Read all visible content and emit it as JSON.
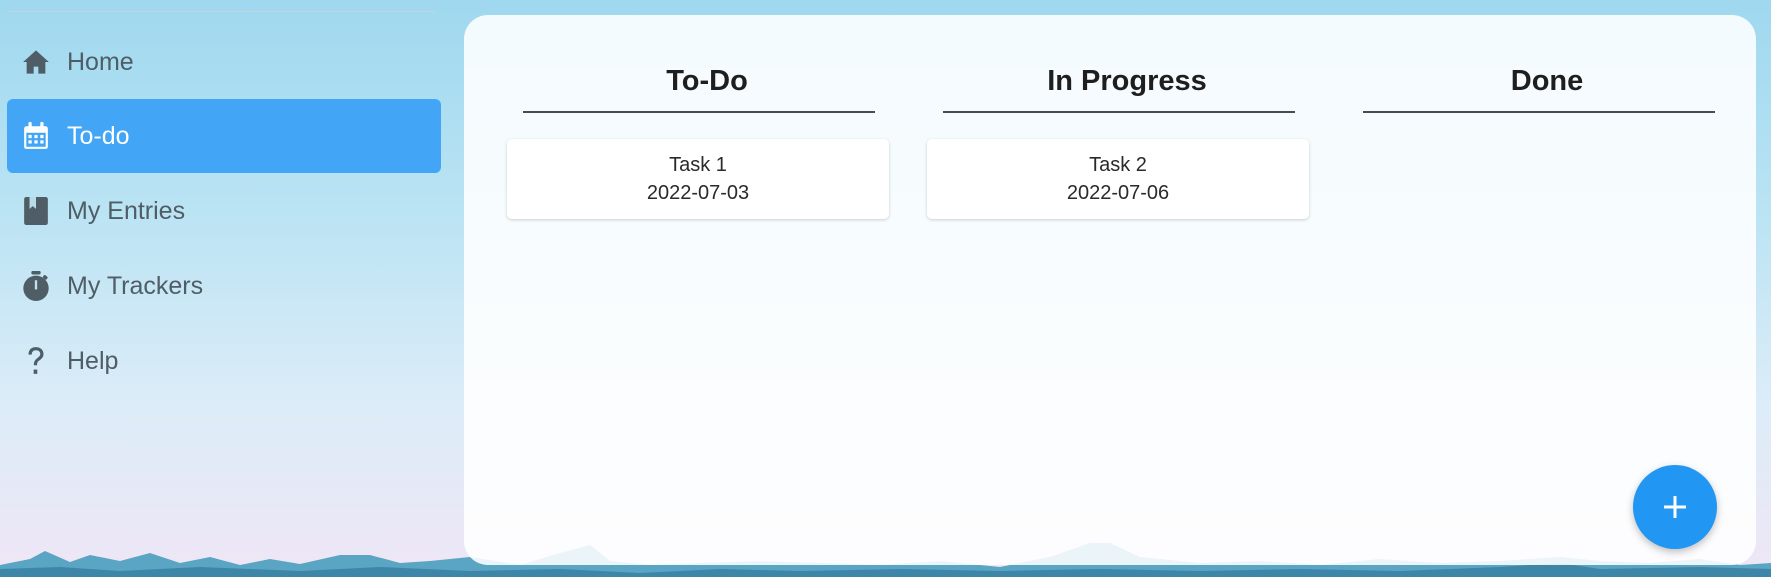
{
  "sidebar": {
    "items": [
      {
        "label": "Home",
        "icon": "home-icon"
      },
      {
        "label": "To-do",
        "icon": "calendar-icon",
        "active": true
      },
      {
        "label": "My Entries",
        "icon": "book-icon"
      },
      {
        "label": "My Trackers",
        "icon": "timer-icon"
      },
      {
        "label": "Help",
        "icon": "help-icon"
      }
    ]
  },
  "board": {
    "columns": [
      {
        "title": "To-Do",
        "cards": [
          {
            "title": "Task 1",
            "date": "2022-07-03"
          }
        ]
      },
      {
        "title": "In Progress",
        "cards": [
          {
            "title": "Task 2",
            "date": "2022-07-06"
          }
        ]
      },
      {
        "title": "Done",
        "cards": []
      }
    ]
  },
  "fab": {
    "icon": "plus-icon"
  },
  "colors": {
    "accent": "#42a5f5",
    "fab": "#2196f3",
    "icon": "#4f5d66"
  }
}
